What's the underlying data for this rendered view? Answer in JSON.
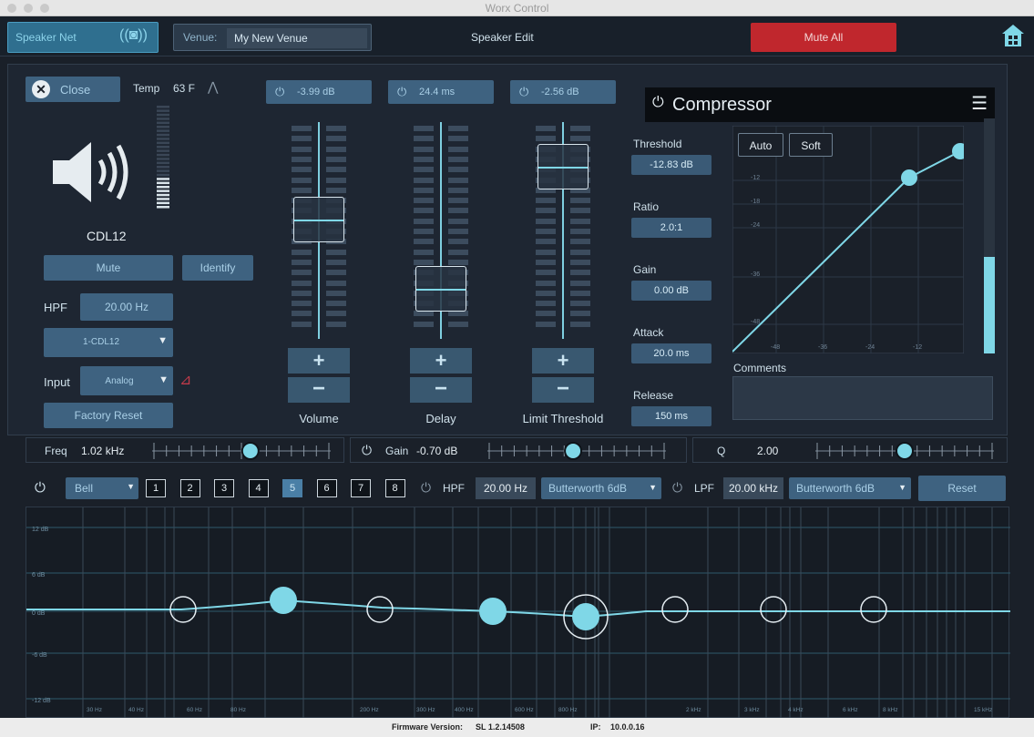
{
  "window": {
    "title": "Worx Control"
  },
  "topbar": {
    "speaker_net_label": "Speaker Net",
    "venue_label": "Venue:",
    "venue_name": "My New Venue",
    "center_title": "Speaker Edit",
    "mute_all_label": "Mute All"
  },
  "speaker": {
    "close_label": "Close",
    "temp_label": "Temp",
    "temp_value": "63 F",
    "model": "CDL12",
    "mute_label": "Mute",
    "identify_label": "Identify",
    "hpf_label": "HPF",
    "hpf_value": "20.00 Hz",
    "preset_value": "1-CDL12",
    "input_label": "Input",
    "input_value": "Analog",
    "factory_reset_label": "Factory Reset"
  },
  "faders": [
    {
      "label": "Volume",
      "value": "-3.99 dB",
      "position": 0.56
    },
    {
      "label": "Delay",
      "value": "24.4 ms",
      "position": 0.15
    },
    {
      "label": "Limit Threshold",
      "value": "-2.56 dB",
      "position": 0.87
    }
  ],
  "compressor": {
    "title": "Compressor",
    "auto_label": "Auto",
    "soft_label": "Soft",
    "threshold_label": "Threshold",
    "threshold_value": "-12.83 dB",
    "ratio_label": "Ratio",
    "ratio_value": "2.0:1",
    "gain_label": "Gain",
    "gain_value": "0.00 dB",
    "attack_label": "Attack",
    "attack_value": "20.0 ms",
    "release_label": "Release",
    "release_value": "150 ms",
    "comments_label": "Comments",
    "y_ticks": [
      "-12",
      "-18",
      "-24",
      "-36",
      "-48"
    ],
    "x_ticks": [
      "-48",
      "-36",
      "-24",
      "-12"
    ],
    "gr_meter_level": 0.41
  },
  "eq_params": {
    "freq_label": "Freq",
    "freq_value": "1.02 kHz",
    "gain_label": "Gain",
    "gain_value": "-0.70 dB",
    "q_label": "Q",
    "q_value": "2.00",
    "freq_slider": 0.55,
    "gain_slider": 0.48,
    "q_slider": 0.5
  },
  "eq_bar": {
    "filter_type": "Bell",
    "bands": [
      "1",
      "2",
      "3",
      "4",
      "5",
      "6",
      "7",
      "8"
    ],
    "selected_band": "5",
    "hpf_label": "HPF",
    "hpf_value": "20.00 Hz",
    "hpf_slope": "Butterworth 6dB",
    "lpf_label": "LPF",
    "lpf_value": "20.00 kHz",
    "lpf_slope": "Butterworth 6dB",
    "reset_label": "Reset"
  },
  "eq_graph": {
    "db_labels": [
      "12 dB",
      "6 dB",
      "0 dB",
      "-6 dB",
      "-12 dB"
    ],
    "freq_labels": [
      "30 Hz",
      "40 Hz",
      "60 Hz",
      "80 Hz",
      "200 Hz",
      "300 Hz",
      "400 Hz",
      "600 Hz",
      "800 Hz",
      "2 kHz",
      "3 kHz",
      "4 kHz",
      "6 kHz",
      "8 kHz",
      "15 kHz"
    ]
  },
  "footer": {
    "firmware_label": "Firmware Version:",
    "firmware_value": "SL 1.2.14508",
    "ip_label": "IP:",
    "ip_value": "10.0.0.16"
  },
  "colors": {
    "accent": "#7fd7e7",
    "mute_all": "#c0272d",
    "panel": "#1e2632",
    "button": "#3e6280"
  }
}
